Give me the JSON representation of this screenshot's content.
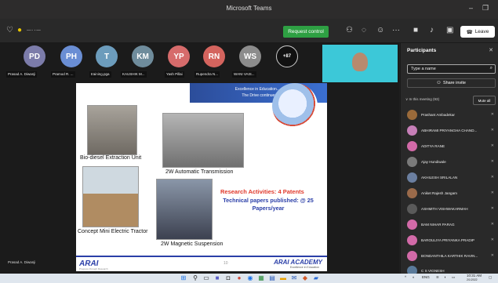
{
  "window": {
    "title": "Microsoft Teams",
    "minimize": "–",
    "restore": "❐"
  },
  "toolbar": {
    "request_control": "Request control",
    "leave": "Leave"
  },
  "participants_strip": [
    {
      "initials": "PD",
      "name": "Prasad A. Diwanji",
      "color": "#7c7caa"
    },
    {
      "initials": "PH",
      "name": "Pramod R. ...",
      "color": "#6a8ed4"
    },
    {
      "initials": "T",
      "name": "training.pga",
      "color": "#6c9cbc"
    },
    {
      "initials": "KM",
      "name": "KAUSHIK M...",
      "color": "#6f8c9c"
    },
    {
      "initials": "YP",
      "name": "Yash Pillai",
      "color": "#d66b6b"
    },
    {
      "initials": "RN",
      "name": "Rupendra N...",
      "color": "#d4645e"
    },
    {
      "initials": "WS",
      "name": "WANI VAIS...",
      "color": "#8c8c8c"
    }
  ],
  "overflow_count": "+87",
  "slide": {
    "banner_line1": "Excellence in Education...",
    "banner_line2": "The Drive continues...",
    "caption_biodiesel": "Bio-diesel Extraction Unit",
    "caption_transmission": "2W Automatic Transmission",
    "caption_tractor": "Concept Mini Electric Tractor",
    "caption_suspension": "2W Magnetic Suspension",
    "research": "Research Activities: 4 Patents",
    "tech_papers": "Technical papers published: @ 25 Papers/year",
    "footer_left": "ARAI",
    "footer_left_sub": "Progress through Research",
    "page_number": "10",
    "footer_right": "ARAI ACADEMY",
    "footer_right_sub": "Excellence in Education"
  },
  "presenter": "Prasad A. Diwanji",
  "panel": {
    "title": "Participants",
    "search_placeholder": "Type a name",
    "share_invite": "Share invite",
    "in_meeting": "∨ In this meeting (93)",
    "mute_all": "Mute all",
    "people": [
      {
        "name": "Prashant Ambadekar",
        "color": "#9a6a3a"
      },
      {
        "name": "ABHIRAMI PRIYANGHA CHAND...",
        "color": "#c77fb8"
      },
      {
        "name": "ADITYA RANE",
        "color": "#d26aa8"
      },
      {
        "name": "Ajay Hundiwale",
        "color": "#7a7a7a"
      },
      {
        "name": "AKHILESH SRILALAN",
        "color": "#6b7fa0"
      },
      {
        "name": "Aniket Rajesh Jangam",
        "color": "#9a6a4a"
      },
      {
        "name": "ASHMITH VISHWAKARMAH",
        "color": "#5a5a5a"
      },
      {
        "name": "BAM NIHAR PARAG",
        "color": "#d26aa8"
      },
      {
        "name": "BAROULIYA PRIYANKA PRADIP",
        "color": "#d26aa8"
      },
      {
        "name": "BONDANTHILA KARTHIK RAVIN...",
        "color": "#d26aa8"
      },
      {
        "name": "C S VIGNESH",
        "color": "#5a7a9a"
      }
    ]
  },
  "taskbar": {
    "language": "ENG",
    "time": "10:31 AM",
    "date": "2/1/2022"
  }
}
